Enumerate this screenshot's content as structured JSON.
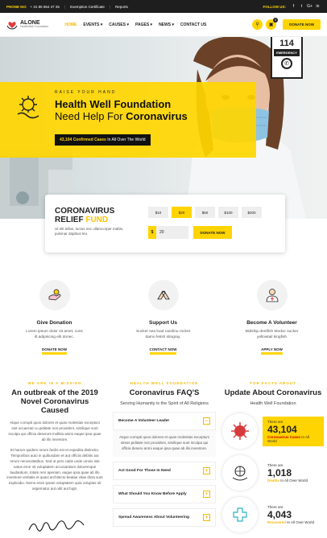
{
  "topbar": {
    "phone_label": "PHONE NO:",
    "phone": "+ 31 85 964 47 25",
    "links": [
      "Exemption Certificate",
      "Reports"
    ],
    "follow_label": "FOLLOW US:",
    "social_icons": [
      "facebook-icon",
      "twitter-icon",
      "google-plus-icon",
      "linkedin-icon"
    ],
    "social_glyphs": [
      "f",
      "t",
      "G+",
      "in"
    ]
  },
  "header": {
    "logo_name": "ALONE",
    "logo_sub": "HealthWell Foundation",
    "nav": [
      "HOME",
      "EVENTS ▾",
      "CAUSES ▾",
      "PAGES ▾",
      "NEWS ▾",
      "CONTACT US"
    ],
    "active_nav": "HOME",
    "cart_count": "0",
    "donate_label": "DONATE NOW"
  },
  "hero": {
    "emergency_number": "114",
    "emergency_label": "EMERGENCY",
    "kicker": "RAISE YOUR HAND",
    "title": "Health Well Foundation",
    "subtitle_pre": "Need Help For",
    "subtitle_bold": "Coronavirus",
    "pill_count": "43,104",
    "pill_bold": "Confirmed Cases",
    "pill_rest": "In All Over The World"
  },
  "relief": {
    "title_line1": "CORONAVIRUS",
    "title_line2_a": "RELIEF",
    "title_line2_b": "FUND",
    "desc": "Ut elit tellus, luctus nec ullamcorper mattis, pulvinar dapibus leo.",
    "amounts": [
      "$10",
      "$20",
      "$50",
      "$100",
      "$200"
    ],
    "selected_amount": "$20",
    "currency": "$",
    "input_value": "20",
    "donate_label": "DONATE NOW"
  },
  "features": [
    {
      "icon": "donation-icon",
      "title": "Give Donation",
      "desc": "Lorem ipsum dolor sit amet, cons ilt adipiscing elit donec.",
      "link": "DONATE NOW"
    },
    {
      "icon": "support-hands-icon",
      "title": "Support Us",
      "desc": "Sucker sea load carolinu rocket damo fetish stingray.",
      "link": "CONTACT NOW"
    },
    {
      "icon": "volunteer-icon",
      "title": "Become A Volunteer",
      "desc": "Midship dentfish Modoc sucker yellowtail kingfish",
      "link": "APPLY NOW"
    }
  ],
  "mission": {
    "kicker": "WE ARE IN A MISSION",
    "heading": "An outbreak of the 2019 Novel Coronavirus Caused",
    "para1": "Atque corrupti quos dolores et quas molestias exceptuni sint occaecati cu piditate non provident, similique sunt inculpa qui officia deserunt mollitia animi eaque ipsa quae ab illo inventore.",
    "para2": "Et harum quidem rerum facilis est et expedita distinctio. Temporibus auto in quibusdam et aut officiis debitis aut rerum necessitatibus. Sed ut pers ciatis unde omnis iste natus error sit voluptatem accusantium doloremque laudantium, totam rem aperiam, eaque ipsa quae ab illo inventore veritatis et quasi architecto beatae vitae dicta sunt explicabo. Nemo enim ipsam voluptatem quia voluptas sit aspernatur aut odit aut fugit."
  },
  "faq": {
    "kicker": "HEALTH WELL FOUNDATION",
    "heading": "Coronavirus FAQ'S",
    "sub": "Serving Humanity is the Spirit of All Religions",
    "items": [
      {
        "q": "Become A Volunteer Leader",
        "open": true,
        "a": "Atque corrupti quos dolores et quas molestias exceptuni sintos piditate non provident, similique sunt inculpa qui officia deseru anmi eaque ipsa quae ab illo inventore."
      },
      {
        "q": "Act Good For Those In Need",
        "open": false
      },
      {
        "q": "What Should You Know Before Apply",
        "open": false
      },
      {
        "q": "Spread Awareness About Volunteering",
        "open": false
      }
    ]
  },
  "facts": {
    "kicker": "FOR FACTS ABOUT",
    "heading": "Update About Coronavirus",
    "sub": "Health Well Foundation",
    "stats": [
      {
        "icon": "virus-icon",
        "pre": "There are",
        "num": "43,104",
        "hl": "Coronavirus Cases",
        "post": "In All World",
        "highlight": true
      },
      {
        "icon": "globe-hands-icon",
        "pre": "There are",
        "num": "1,018",
        "hl": "Deaths",
        "post": "In All Over World",
        "highlight": false
      },
      {
        "icon": "medical-hand-icon",
        "pre": "There are",
        "num": "4,043",
        "hl": "Recovered",
        "post": "In All Over World",
        "highlight": false
      }
    ]
  },
  "colors": {
    "accent": "#ffd400",
    "dark": "#1e1e1e",
    "virus_red": "#d63a3a"
  }
}
